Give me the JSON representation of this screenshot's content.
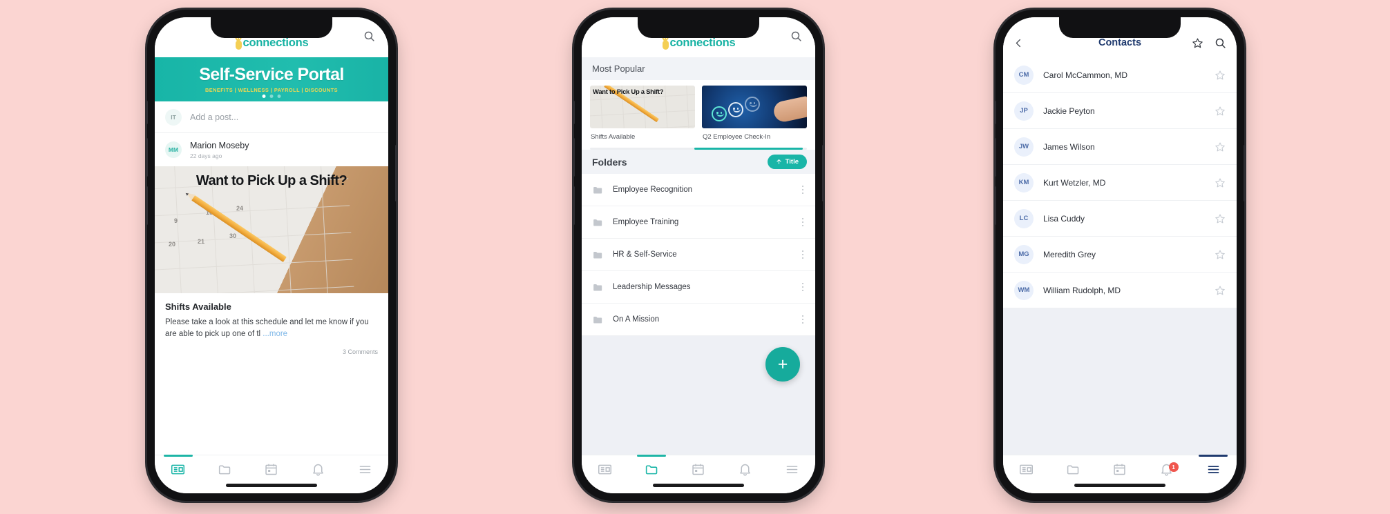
{
  "background_color": "#fbd5d2",
  "accent_teal": "#19b5a7",
  "accent_navy": "#1f3a6e",
  "badge_red": "#f0564e",
  "app": {
    "logo_text": "connections"
  },
  "phone1": {
    "banner": {
      "title": "Self-Service Portal",
      "subtitle": "BENEFITS  |  WELLNESS  |  PAYROLL  |  DISCOUNTS",
      "dot_count": 3,
      "active_dot": 0
    },
    "composer": {
      "avatar_initials": "IT",
      "placeholder": "Add a post..."
    },
    "post": {
      "author_initials": "MM",
      "author": "Marion Moseby",
      "timestamp": "22 days ago",
      "image_overlay_title": "Want to Pick Up a Shift?",
      "title": "Shifts Available",
      "body": "Please take a look at this schedule and let me know if you are able to pick up one of tl",
      "more_label": "...more",
      "comments": "3 Comments"
    },
    "nav": [
      {
        "name": "news",
        "icon": "newspaper-icon",
        "active": true
      },
      {
        "name": "folders",
        "icon": "folder-icon",
        "active": false
      },
      {
        "name": "calendar",
        "icon": "calendar-icon",
        "active": false
      },
      {
        "name": "notifications",
        "icon": "bell-icon",
        "active": false
      },
      {
        "name": "menu",
        "icon": "hamburger-icon",
        "active": false
      }
    ]
  },
  "phone2": {
    "section_most_popular": "Most Popular",
    "cards": [
      {
        "caption": "Shifts Available",
        "overlay_title": "Want to Pick Up a Shift?"
      },
      {
        "caption": "Q2 Employee Check-In",
        "overlay_title": ""
      }
    ],
    "folders_header": "Folders",
    "sort_label": "Title",
    "sort_icon": "sort-ascending-icon",
    "folders": [
      {
        "name": "Employee Recognition"
      },
      {
        "name": "Employee Training"
      },
      {
        "name": "HR & Self-Service"
      },
      {
        "name": "Leadership Messages"
      },
      {
        "name": "On A Mission"
      }
    ],
    "fab_label": "+",
    "nav": [
      {
        "name": "news",
        "icon": "newspaper-icon",
        "active": false
      },
      {
        "name": "folders",
        "icon": "folder-icon",
        "active": true
      },
      {
        "name": "calendar",
        "icon": "calendar-icon",
        "active": false
      },
      {
        "name": "notifications",
        "icon": "bell-icon",
        "active": false
      },
      {
        "name": "menu",
        "icon": "hamburger-icon",
        "active": false
      }
    ]
  },
  "phone3": {
    "title": "Contacts",
    "back_icon": "chevron-left-icon",
    "star_icon": "star-outline-icon",
    "search_icon": "search-icon",
    "contacts": [
      {
        "initials": "CM",
        "name": "Carol McCammon, MD"
      },
      {
        "initials": "JP",
        "name": "Jackie Peyton"
      },
      {
        "initials": "JW",
        "name": "James Wilson"
      },
      {
        "initials": "KM",
        "name": "Kurt Wetzler, MD"
      },
      {
        "initials": "LC",
        "name": "Lisa Cuddy"
      },
      {
        "initials": "MG",
        "name": "Meredith Grey"
      },
      {
        "initials": "WM",
        "name": "William Rudolph, MD"
      }
    ],
    "nav": [
      {
        "name": "news",
        "icon": "newspaper-icon",
        "active": false
      },
      {
        "name": "folders",
        "icon": "folder-icon",
        "active": false
      },
      {
        "name": "calendar",
        "icon": "calendar-icon",
        "active": false
      },
      {
        "name": "notifications",
        "icon": "bell-icon",
        "active": false,
        "badge": "1"
      },
      {
        "name": "menu",
        "icon": "hamburger-icon",
        "active": true
      }
    ]
  }
}
